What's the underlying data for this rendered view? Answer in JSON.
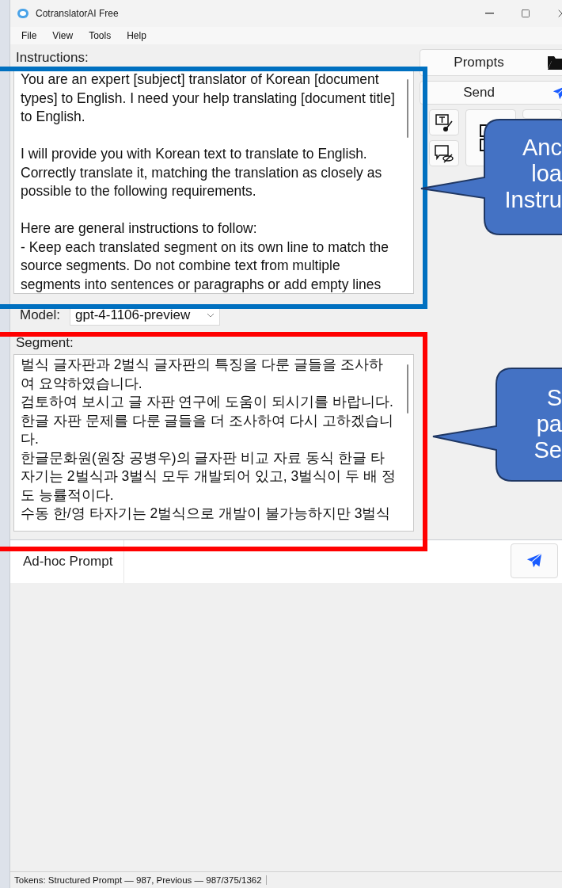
{
  "window": {
    "title": "CotranslatorAI Free"
  },
  "menu": [
    "File",
    "View",
    "Tools",
    "Help"
  ],
  "instructions": {
    "label": "Instructions:",
    "value": "You are an expert [subject] translator of Korean [document types] to English. I need your help translating [document title] to English.\n\nI will provide you with Korean text to translate to English. Correctly translate it, matching the translation as closely as possible to the following requirements.\n\nHere are general instructions to follow:\n- Keep each translated segment on its own line to match the source segments. Do not combine text from multiple segments into sentences or paragraphs or add empty lines"
  },
  "model": {
    "label": "Model:",
    "value": "gpt-4-1106-preview"
  },
  "segment": {
    "label": "Segment:",
    "value": "벌식 글자판과 2벌식 글자판의 특징을 다룬 글들을 조사하여 요약하였습니다.\n검토하여 보시고 글 자판 연구에 도움이 되시기를 바랍니다.\n한글 자판 문제를 다룬 글들을 더 조사하여 다시 고하겠습니다.\n한글문화원(원장 공병우)의 글자판 비교 자료 동식 한글 타자기는 2벌식과 3벌식 모두 개발되어 있고, 3벌식이 두 배 정도 능률적이다.\n수동 한/영 타자기는 2벌식으로 개발이 불가능하지만 3벌식"
  },
  "side_buttons": [
    {
      "label": "Prompts",
      "kind": "folder"
    },
    {
      "label": "Send",
      "kind": "send"
    }
  ],
  "tool_buttons": [
    {
      "kind": "text-edit"
    },
    {
      "kind": "window-pair"
    },
    {
      "kind": "hidden-chat"
    }
  ],
  "adhoc": {
    "label": "Ad-hoc Prompt"
  },
  "status_bar": "Tokens: Structured Prompt — 987, Previous — 987/375/1362",
  "annotations": [
    {
      "kind": "box",
      "color": "#0070c0"
    },
    {
      "kind": "box",
      "color": "#ff0000"
    },
    {
      "kind": "callout",
      "lines": [
        "Anc",
        "loa",
        "Instru"
      ]
    },
    {
      "kind": "callout",
      "lines": [
        "S",
        "pa",
        "Se"
      ]
    }
  ]
}
